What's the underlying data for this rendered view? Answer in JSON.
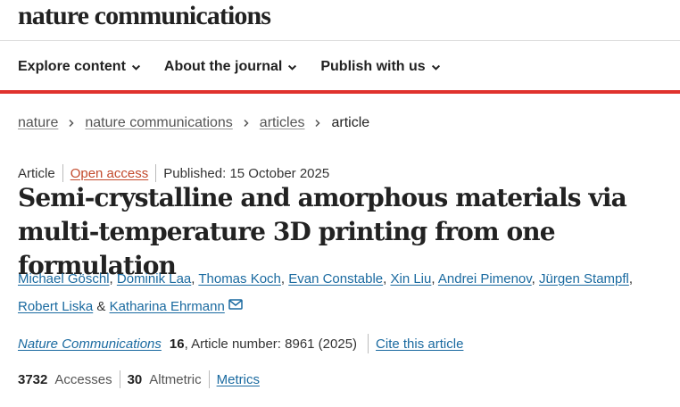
{
  "site": {
    "brand": "nature communications"
  },
  "nav": {
    "items": [
      {
        "label": "Explore content"
      },
      {
        "label": "About the journal"
      },
      {
        "label": "Publish with us"
      }
    ]
  },
  "breadcrumb": {
    "items": [
      "nature",
      "nature communications",
      "articles"
    ],
    "current": "article"
  },
  "article": {
    "type": "Article",
    "access": "Open access",
    "published": "Published: 15 October 2025",
    "title": "Semi-crystalline and amorphous materials via multi-temperature 3D printing from one formulation",
    "authors": [
      "Michael Göschl",
      "Dominik Laa",
      "Thomas Koch",
      "Evan Constable",
      "Xin Liu",
      "Andrei Pimenov",
      "Jürgen Stampfl",
      "Robert Liska",
      "Katharina Ehrmann"
    ],
    "author_sep": ", ",
    "author_last_sep": " & ",
    "journal": "Nature Communications",
    "volume": "16",
    "article_number": ", Article number: 8961 (2025)",
    "cite_label": "Cite this article"
  },
  "metrics": {
    "accesses_count": "3732",
    "accesses_label": "Accesses",
    "altmetric_count": "30",
    "altmetric_label": "Altmetric",
    "metrics_link": "Metrics"
  },
  "icons": {
    "chevron": "chevron-down-icon",
    "breadcrumb_sep": "chevron-right-icon",
    "mail": "mail-icon"
  },
  "colors": {
    "accent_red": "#e0322d",
    "link_blue": "#1a6aa0",
    "open_access": "#c34a2c"
  }
}
